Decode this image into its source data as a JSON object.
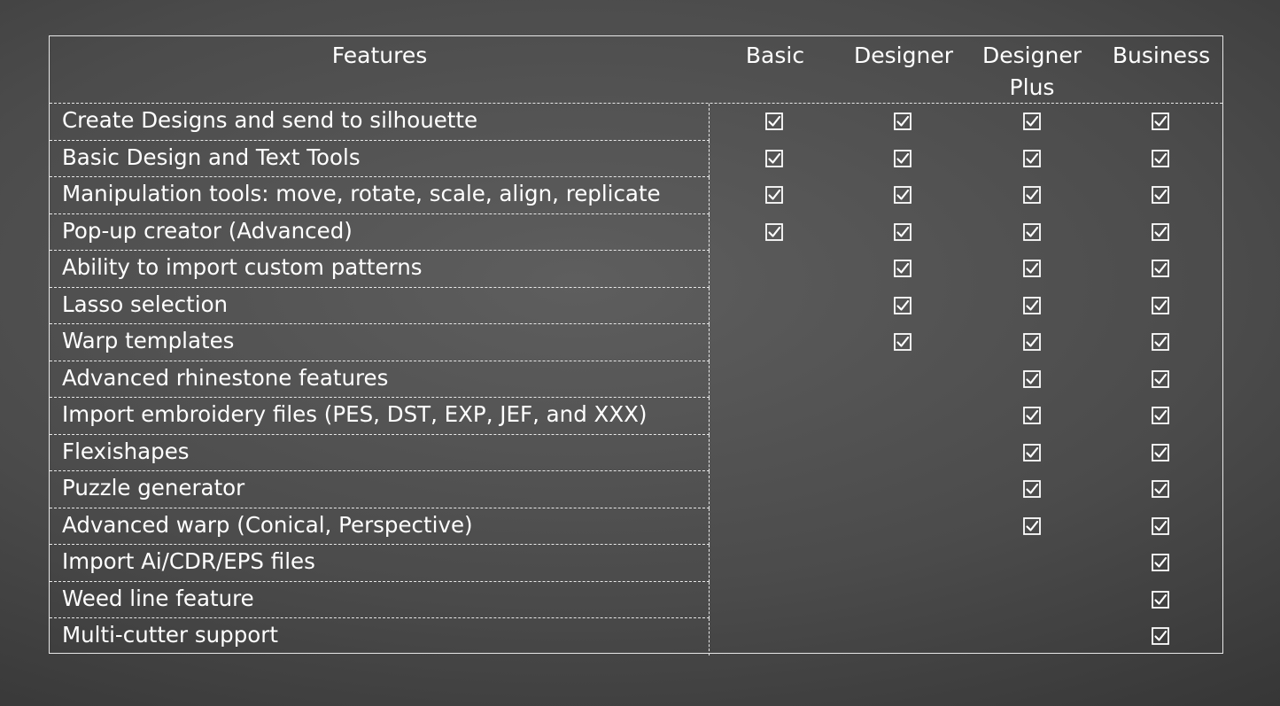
{
  "table": {
    "headers": [
      "Features",
      "Basic",
      "Designer",
      "Designer Plus",
      "Business"
    ],
    "rows": [
      {
        "feature": "Create Designs and send to silhouette",
        "checks": [
          true,
          true,
          true,
          true
        ]
      },
      {
        "feature": "Basic Design and Text Tools",
        "checks": [
          true,
          true,
          true,
          true
        ]
      },
      {
        "feature": "Manipulation tools: move, rotate, scale, align, replicate",
        "checks": [
          true,
          true,
          true,
          true
        ]
      },
      {
        "feature": "Pop-up creator (Advanced)",
        "checks": [
          true,
          true,
          true,
          true
        ]
      },
      {
        "feature": "Ability to import custom patterns",
        "checks": [
          false,
          true,
          true,
          true
        ]
      },
      {
        "feature": "Lasso selection",
        "checks": [
          false,
          true,
          true,
          true
        ]
      },
      {
        "feature": "Warp templates",
        "checks": [
          false,
          true,
          true,
          true
        ]
      },
      {
        "feature": "Advanced rhinestone features",
        "checks": [
          false,
          false,
          true,
          true
        ]
      },
      {
        "feature": "Import embroidery files (PES, DST, EXP, JEF, and XXX)",
        "checks": [
          false,
          false,
          true,
          true
        ]
      },
      {
        "feature": "Flexishapes",
        "checks": [
          false,
          false,
          true,
          true
        ]
      },
      {
        "feature": "Puzzle generator",
        "checks": [
          false,
          false,
          true,
          true
        ]
      },
      {
        "feature": "Advanced warp (Conical, Perspective)",
        "checks": [
          false,
          false,
          true,
          true
        ]
      },
      {
        "feature": "Import Ai/CDR/EPS files",
        "checks": [
          false,
          false,
          false,
          true
        ]
      },
      {
        "feature": "Weed line feature",
        "checks": [
          false,
          false,
          false,
          true
        ]
      },
      {
        "feature": "Multi-cutter support",
        "checks": [
          false,
          false,
          false,
          true
        ]
      }
    ]
  },
  "icons": {
    "check": "checked-box-icon"
  },
  "colors": {
    "text": "#ffffff",
    "border": "#e8e8e8"
  }
}
